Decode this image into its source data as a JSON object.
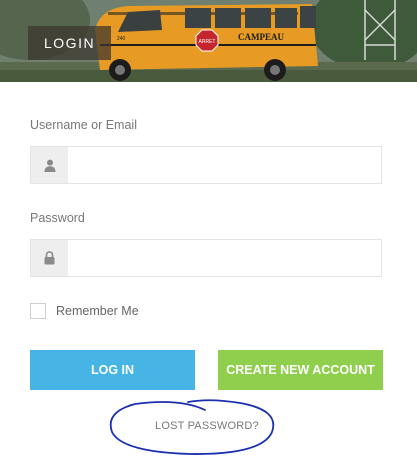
{
  "header": {
    "tab_label": "LOGIN",
    "bus_label": "CAMPEAU",
    "stop_sign": "ARRET"
  },
  "form": {
    "username": {
      "label": "Username or Email",
      "value": "",
      "placeholder": "",
      "icon": "user-icon"
    },
    "password": {
      "label": "Password",
      "value": "",
      "placeholder": "",
      "icon": "lock-icon"
    },
    "remember_me": {
      "label": "Remember Me",
      "checked": false
    },
    "login_button": "LOG IN",
    "create_account_button": "CREATE NEW ACCOUNT",
    "lost_password_link": "LOST PASSWORD?"
  },
  "colors": {
    "login_button": "#46b4e5",
    "create_button": "#8fcf4d",
    "annotation_circle": "#1a2fb0",
    "bus_body": "#e79a24"
  }
}
